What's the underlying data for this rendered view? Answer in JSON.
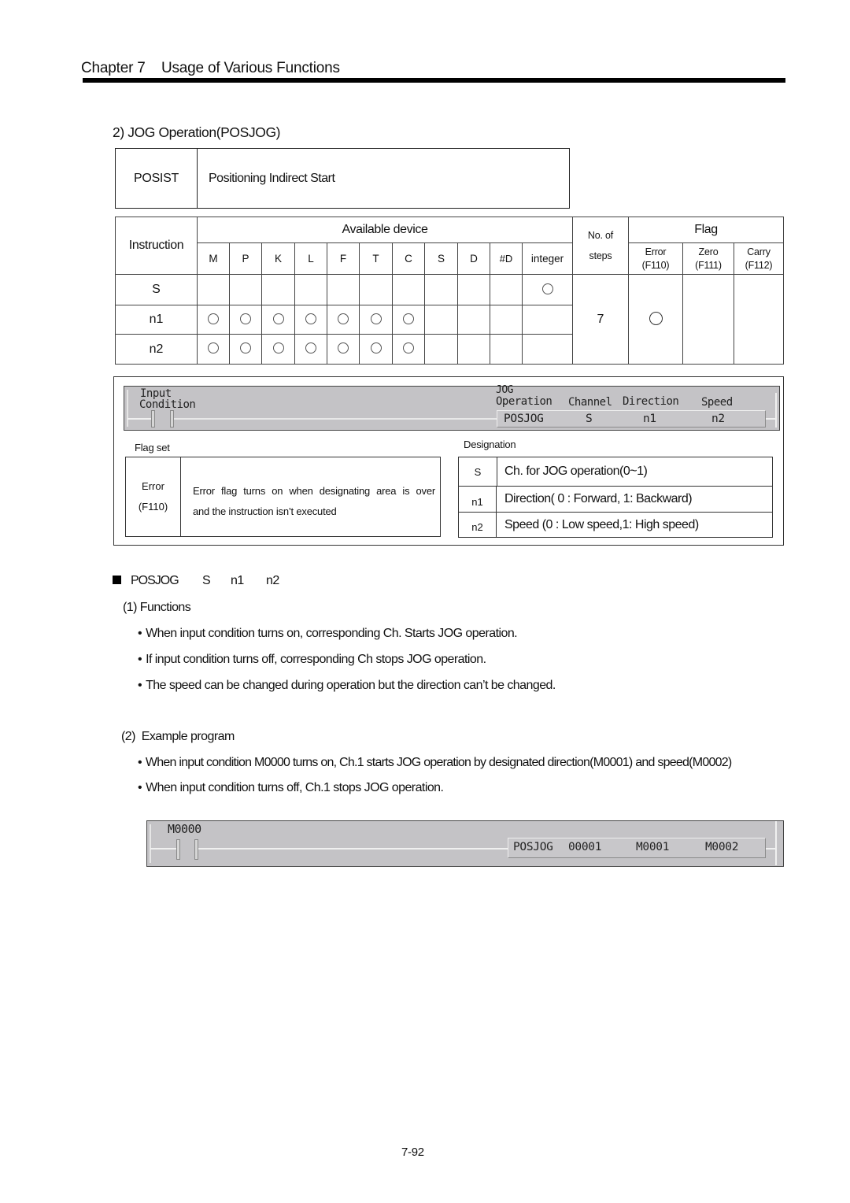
{
  "header": {
    "chapter": "Chapter 7",
    "chapter_title": "Usage of Various Functions"
  },
  "section": {
    "title": "2) JOG Operation(POSJOG)"
  },
  "instruction_box": {
    "code": "POSIST",
    "description": "Positioning Indirect Start"
  },
  "device_table": {
    "instruction_header": "Instruction",
    "available_device_header": "Available device",
    "devices": [
      "M",
      "P",
      "K",
      "L",
      "F",
      "T",
      "C",
      "S",
      "D",
      "#D",
      "integer"
    ],
    "steps_header_line1": "No. of",
    "steps_header_line2": "steps",
    "flag_header": "Flag",
    "flags": [
      {
        "name": "Error",
        "code": "(F110)"
      },
      {
        "name": "Zero",
        "code": "(F111)"
      },
      {
        "name": "Carry",
        "code": "(F112)"
      }
    ],
    "rows": [
      {
        "operand": "S",
        "available": [
          false,
          false,
          false,
          false,
          false,
          false,
          false,
          false,
          false,
          false,
          true
        ]
      },
      {
        "operand": "n1",
        "available": [
          true,
          true,
          true,
          true,
          true,
          true,
          true,
          false,
          false,
          false,
          false
        ]
      },
      {
        "operand": "n2",
        "available": [
          true,
          true,
          true,
          true,
          true,
          true,
          true,
          false,
          false,
          false,
          false
        ]
      }
    ],
    "steps": "7",
    "flag_set": [
      true,
      false,
      false
    ]
  },
  "ladder_diagram": {
    "input_label_line1": "Input",
    "input_label_line2": "Condition",
    "jog_label_line1": "JOG",
    "jog_label_line2": "Operation",
    "channel_label": "Channel",
    "direction_label": "Direction",
    "speed_label": "Speed",
    "instruction": "POSJOG",
    "operand_s": "S",
    "operand_n1": "n1",
    "operand_n2": "n2"
  },
  "flag_set": {
    "caption": "Flag set",
    "flag_name": "Error",
    "flag_code": "(F110)",
    "description_line1": "Error flag turns on when designating area is over",
    "description_line2": "and the instruction isn’t executed"
  },
  "designation": {
    "caption": "Designation",
    "rows": [
      {
        "key": "S",
        "value": "Ch. for JOG operation(0~1)"
      },
      {
        "key": "n1",
        "value": "Direction( 0 : Forward, 1: Backward)"
      },
      {
        "key": "n2",
        "value": "Speed (0 : Low speed,1: High speed)"
      }
    ]
  },
  "syntax": {
    "instruction": "POSJOG",
    "s": "S",
    "n1": "n1",
    "n2": "n2"
  },
  "functions": {
    "heading": "(1) Functions",
    "bullets": [
      "When input condition turns on, corresponding Ch. Starts JOG operation.",
      "If input condition turns off, corresponding Ch stops JOG operation.",
      "The speed can be changed during operation but the direction can’t be changed."
    ]
  },
  "example": {
    "heading": "(2)  Example program",
    "bullets": [
      "When input condition M0000 turns on, Ch.1 starts JOG operation by designated direction(M0001) and speed(M0002)",
      "When input condition turns off, Ch.1 stops JOG operation."
    ],
    "ladder": {
      "contact": "M0000",
      "instruction": "POSJOG",
      "channel": "00001",
      "direction": "M0001",
      "speed": "M0002"
    }
  },
  "footer": {
    "page_number": "7-92"
  }
}
